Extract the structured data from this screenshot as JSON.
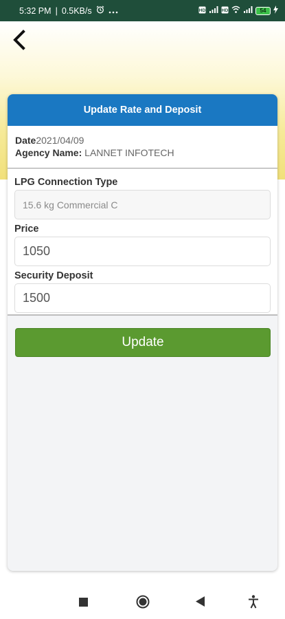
{
  "status_bar": {
    "time": "5:32 PM",
    "speed": "0.5KB/s",
    "battery": "54"
  },
  "card": {
    "title": "Update Rate and Deposit",
    "date_label": "Date",
    "date_value": "2021/04/09",
    "agency_label": "Agency Name:",
    "agency_value": "LANNET INFOTECH"
  },
  "form": {
    "connection_type_label": "LPG Connection Type",
    "connection_type_value": "15.6 kg Commercial C",
    "price_label": "Price",
    "price_value": "1050",
    "deposit_label": "Security Deposit",
    "deposit_value": "1500"
  },
  "actions": {
    "update_label": "Update"
  }
}
